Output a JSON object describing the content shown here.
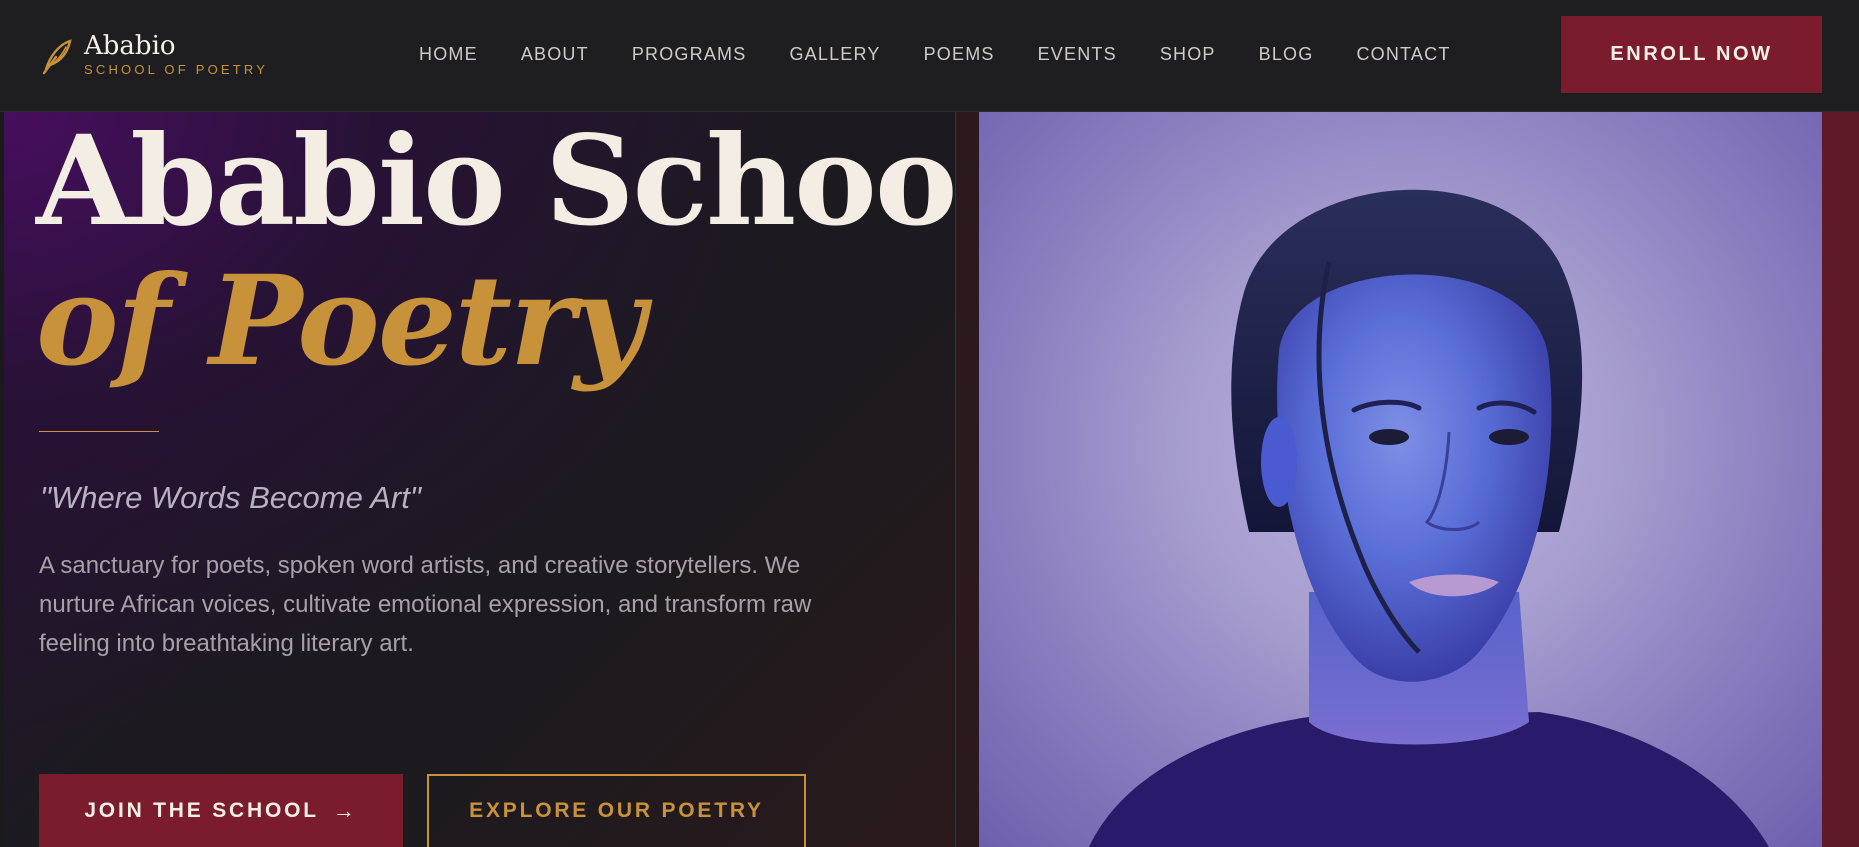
{
  "brand": {
    "name": "Ababio",
    "subtitle": "SCHOOL OF POETRY",
    "icon": "feather-icon"
  },
  "nav": {
    "items": [
      "HOME",
      "ABOUT",
      "PROGRAMS",
      "GALLERY",
      "POEMS",
      "EVENTS",
      "SHOP",
      "BLOG",
      "CONTACT"
    ]
  },
  "header": {
    "enroll_label": "ENROLL NOW"
  },
  "hero": {
    "title_line1": "Ababio School",
    "title_line2": "of Poetry",
    "tagline": "\"Where Words Become Art\"",
    "description": "A sanctuary for poets, spoken word artists, and creative storytellers. We nurture African voices, cultivate emotional expression, and transform raw feeling into breathtaking literary art.",
    "join_label": "JOIN THE SCHOOL",
    "join_icon": "arrow-right-icon",
    "explore_label": "EXPLORE OUR POETRY"
  },
  "colors": {
    "accent_gold": "#c8923a",
    "accent_burgundy": "#7a1c2b",
    "header_bg": "#1e1e20",
    "text_light": "#f3ede4"
  }
}
